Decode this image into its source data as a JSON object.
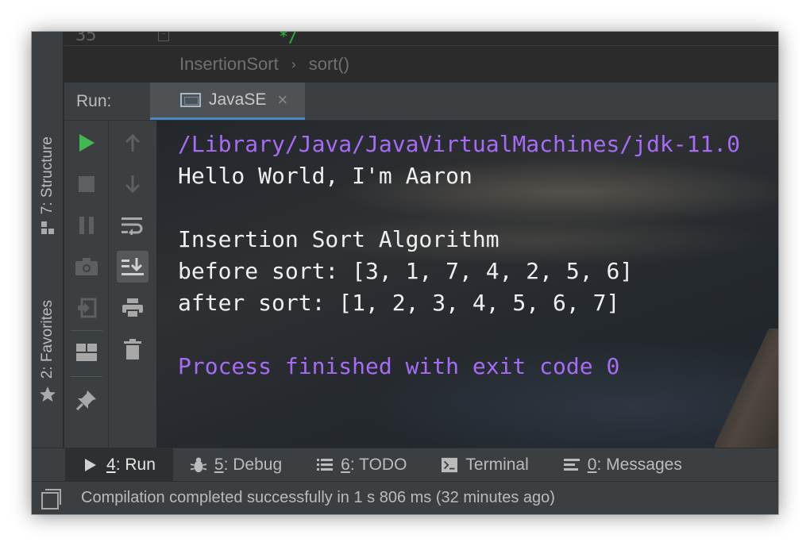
{
  "editor": {
    "line_number": "35",
    "code_tail": "*/"
  },
  "breadcrumb": {
    "class_name": "InsertionSort",
    "separator": "›",
    "method_name": "sort()"
  },
  "left_strip": {
    "structure_tab": "7: Structure",
    "favorites_tab": "2: Favorites"
  },
  "run_panel": {
    "label": "Run:",
    "tab_label": "JavaSE",
    "tab_close": "×"
  },
  "console": {
    "lines": [
      "/Library/Java/JavaVirtualMachines/jdk-11.0",
      "Hello World, I'm Aaron",
      "",
      "Insertion Sort Algorithm",
      "before sort: [3, 1, 7, 4, 2, 5, 6]",
      "after sort: [1, 2, 3, 4, 5, 6, 7]",
      "",
      "Process finished with exit code 0"
    ]
  },
  "bottom_tabs": {
    "run": {
      "mnemonic": "4",
      "label": ": Run"
    },
    "debug": {
      "mnemonic": "5",
      "label": ": Debug"
    },
    "todo": {
      "mnemonic": "6",
      "label": ": TODO"
    },
    "terminal": {
      "label": "Terminal"
    },
    "messages": {
      "mnemonic": "0",
      "label": ": Messages"
    }
  },
  "status_bar": {
    "message": "Compilation completed successfully in 1 s 806 ms (32 minutes ago)"
  },
  "colors": {
    "console_path": "#a66cf5",
    "run_green": "#3fb950",
    "editor_bg": "#2b2b2b",
    "panel_bg": "#3c3f41"
  }
}
